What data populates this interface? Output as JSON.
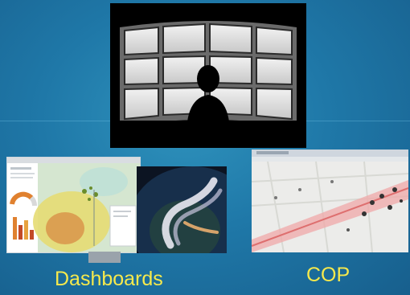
{
  "captions": {
    "dashboards": "Dashboards",
    "cop": "COP"
  },
  "colors": {
    "background": "#1f78a8",
    "caption": "#f6e94c",
    "tile": "#000000"
  },
  "icons": {
    "videowall": "video-wall-operator-icon",
    "dashboard_map": "dashboard-map-thumbnail",
    "dashboard_globe": "dashboard-globe-thumbnail",
    "cop_map": "cop-map-thumbnail"
  }
}
